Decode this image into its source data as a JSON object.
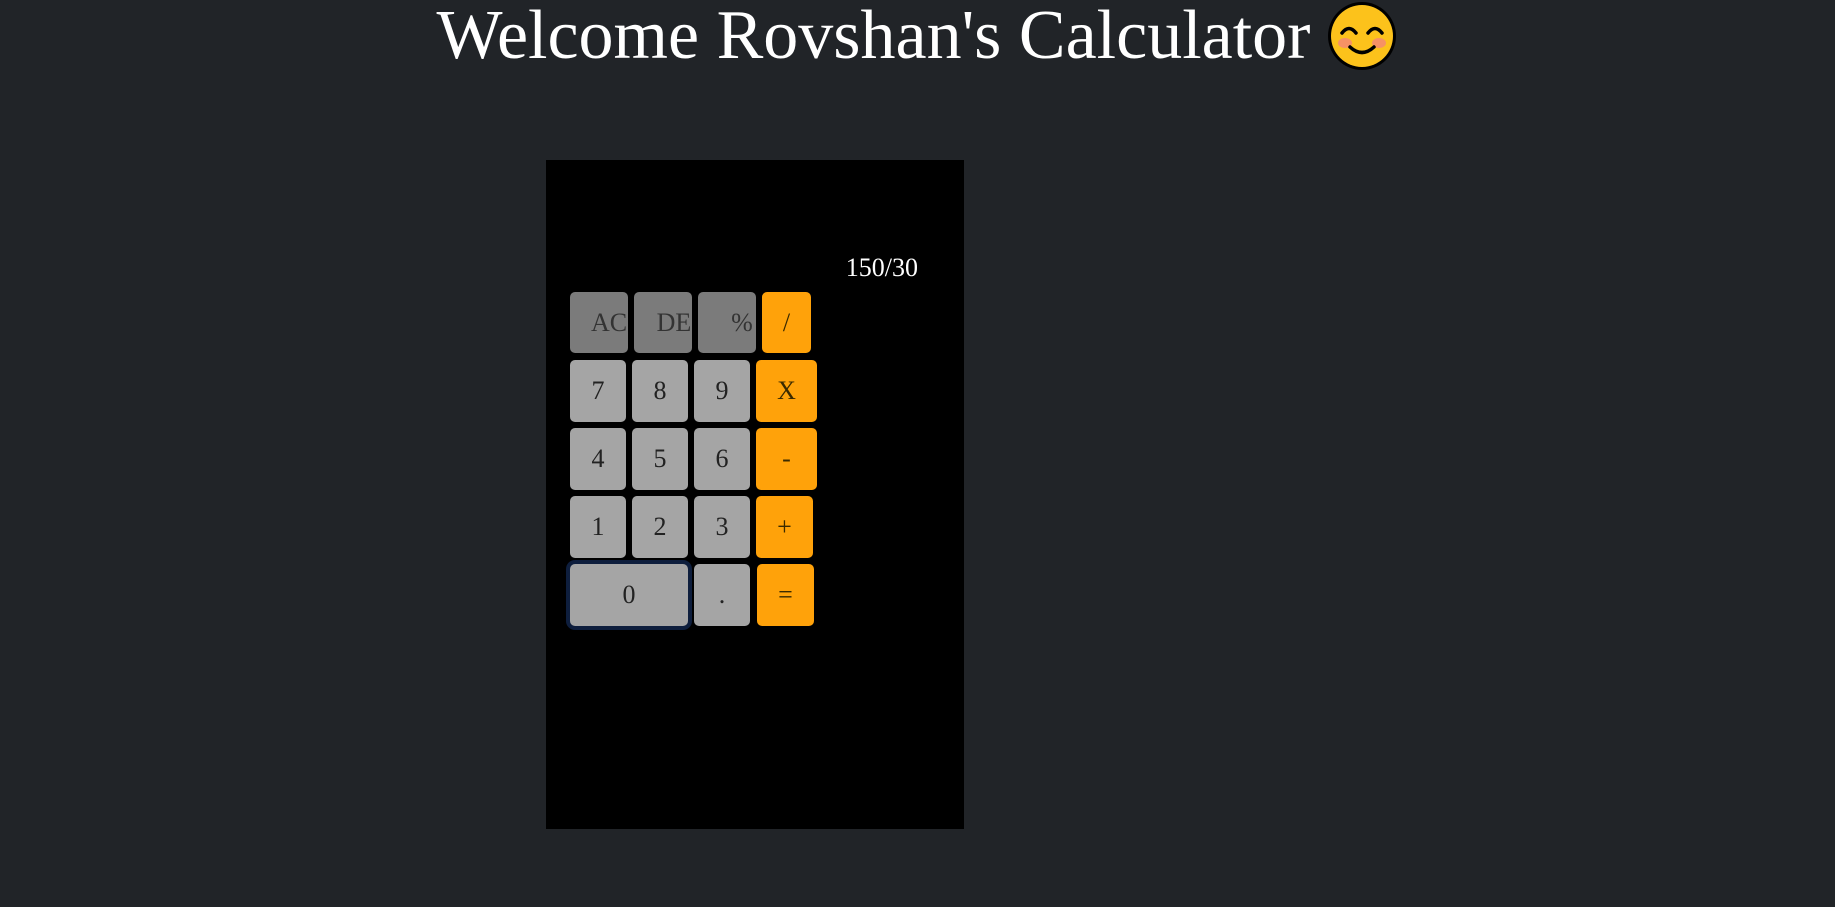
{
  "header": {
    "title": "Welcome Rovshan's Calculator"
  },
  "calculator": {
    "display": "150/30",
    "keys": {
      "ac": "AC",
      "de": "DE",
      "percent": "%",
      "divide": "/",
      "seven": "7",
      "eight": "8",
      "nine": "9",
      "multiply": "X",
      "four": "4",
      "five": "5",
      "six": "6",
      "minus": "-",
      "one": "1",
      "two": "2",
      "three": "3",
      "plus": "+",
      "zero": "0",
      "dot": ".",
      "equals": "="
    }
  },
  "colors": {
    "background": "#212428",
    "calculator_body": "#000000",
    "function_key": "#7b7b7b",
    "number_key": "#a5a5a5",
    "operator_key": "#ffa20a"
  },
  "icons": {
    "title_emoji": "smiling-face-icon"
  }
}
